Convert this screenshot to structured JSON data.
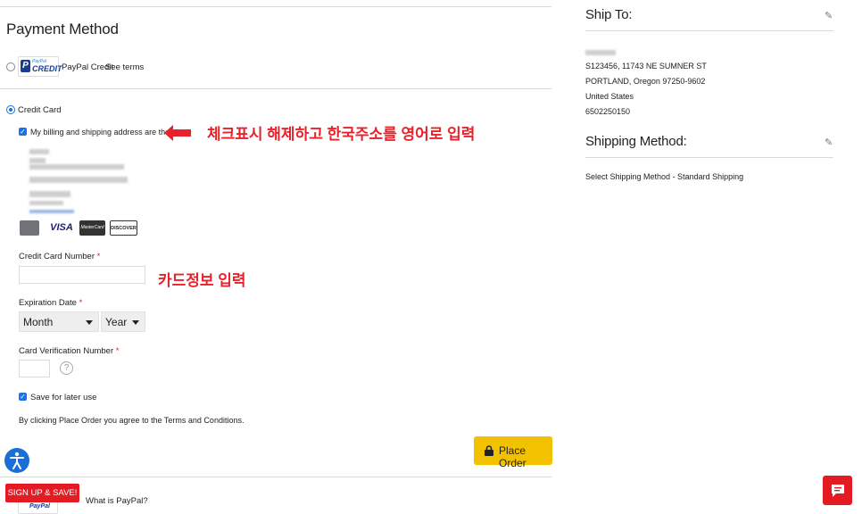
{
  "payment": {
    "title": "Payment Method",
    "paypal_credit": {
      "logo_small": "PayPal",
      "logo_big": "CREDIT",
      "label": "PayPal Credit",
      "see_terms": "See terms"
    },
    "credit_card_label": "Credit Card",
    "same_address_label": "My billing and shipping address are the same",
    "annotation_address": "체크표시 해제하고 한국주소를 영어로 입력",
    "annotation_card": "카드정보 입력",
    "card_logos": [
      "AMEX",
      "VISA",
      "MasterCard",
      "DISCOVER"
    ],
    "card_number_label": "Credit Card Number",
    "required_mark": "*",
    "expiration_label": "Expiration Date",
    "month_selected": "Month",
    "year_selected": "Year",
    "cvn_label": "Card Verification Number",
    "help_icon": "?",
    "save_label": "Save for later use",
    "terms_text": "By clicking Place Order you agree to the Terms and Conditions.",
    "place_order": "Place Order",
    "paypal_bottom_logo": "PayPal",
    "what_is_paypal": "What is PayPal?"
  },
  "signup": {
    "label": "SIGN UP & SAVE!"
  },
  "ship_to": {
    "title": "Ship To:",
    "address_line1": "S123456, 11743 NE SUMNER ST",
    "address_line2": "PORTLAND, Oregon 97250-9602",
    "country": "United States",
    "phone": "6502250150"
  },
  "shipping_method": {
    "title": "Shipping Method:",
    "value": "Select Shipping Method - Standard Shipping"
  },
  "colors": {
    "accent": "#1a73e8",
    "place_order_bg": "#f2c200",
    "annotation": "#e8222b",
    "signup_bg": "#e31b23"
  },
  "icons": [
    "pencil-icon",
    "lock-icon",
    "accessibility-icon",
    "chat-icon",
    "arrow-left-icon",
    "help-icon",
    "chevron-down-icon"
  ]
}
